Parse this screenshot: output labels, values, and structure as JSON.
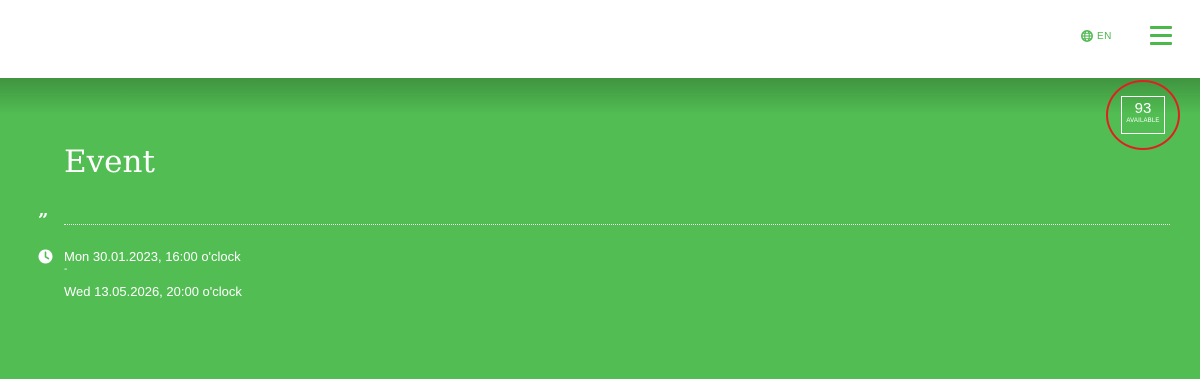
{
  "header": {
    "language": "EN",
    "language_icon": "globe-icon",
    "menu_icon": "hamburger-menu-icon"
  },
  "event": {
    "title": "Event",
    "quote_icon": "quote-icon",
    "availability": {
      "count": "93",
      "label": "AVAILABLE"
    },
    "schedule": {
      "icon": "clock-icon",
      "start": "Mon 30.01.2023, 16:00 o'clock",
      "separator": "-",
      "end": "Wed 13.05.2026, 20:00 o'clock"
    }
  },
  "colors": {
    "brand_green": "#51bd52",
    "accent_green": "#4cb84c",
    "highlight_ring": "#e02020",
    "text_on_brand": "#ffffff"
  }
}
